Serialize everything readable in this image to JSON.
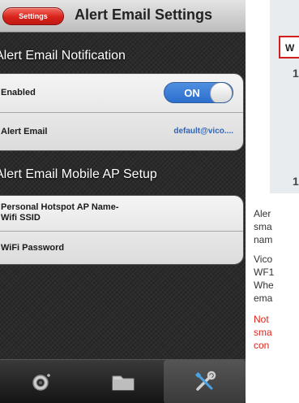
{
  "navbar": {
    "back_label": "Settings",
    "title": "Alert Email Settings"
  },
  "sections": {
    "notification": "Alert Email Notification",
    "mobile_ap": "Alert Email Mobile AP Setup"
  },
  "notification_rows": {
    "enabled_label": "Enabled",
    "toggle_state": "ON",
    "email_label": "Alert Email",
    "email_value": "default@vico...."
  },
  "ap_rows": {
    "hotspot_label": "Personal Hotspot AP Name-Wifi SSID",
    "password_label": "WiFi Password"
  },
  "tabbar": {
    "tabs": [
      "camera-icon",
      "folder-icon",
      "wrench-screwdriver-icon"
    ],
    "active": "wrench-screwdriver-icon"
  },
  "doc": {
    "w_letter": "W",
    "digit_1": "1",
    "digit_2": "1",
    "lines": [
      "Aler",
      "sma",
      "nam",
      "Vico",
      "WF1",
      "Whe",
      "ema",
      "Not",
      "sma",
      "con"
    ]
  },
  "colors": {
    "accent_red": "#d8231b",
    "toggle_blue": "#2c6fcd",
    "email_blue": "#2f66b8",
    "note_red": "#e0241b"
  }
}
